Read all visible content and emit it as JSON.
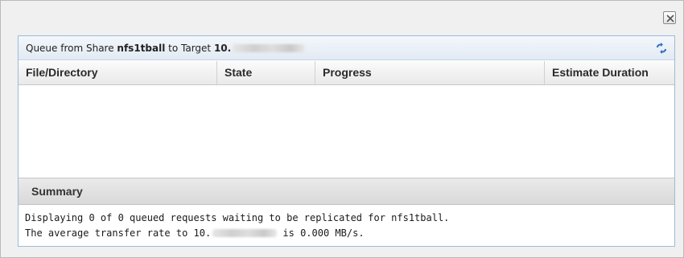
{
  "dialog": {
    "close_icon": "close-icon"
  },
  "panel": {
    "title_prefix": "Queue from Share ",
    "share_name": "nfs1tball",
    "title_mid": " to Target ",
    "target_prefix": "10.",
    "refresh_icon": "refresh-icon"
  },
  "table": {
    "columns": [
      "File/Directory",
      "State",
      "Progress",
      "Estimate Duration"
    ],
    "rows": []
  },
  "summary": {
    "heading": "Summary",
    "line1": "Displaying 0 of 0 queued requests waiting to be replicated for nfs1tball.",
    "line2_prefix": "The average transfer rate to 10.",
    "line2_suffix": " is 0.000 MB/s."
  },
  "colors": {
    "panel_border": "#9dbbd9",
    "refresh_icon": "#2f6fc4"
  }
}
